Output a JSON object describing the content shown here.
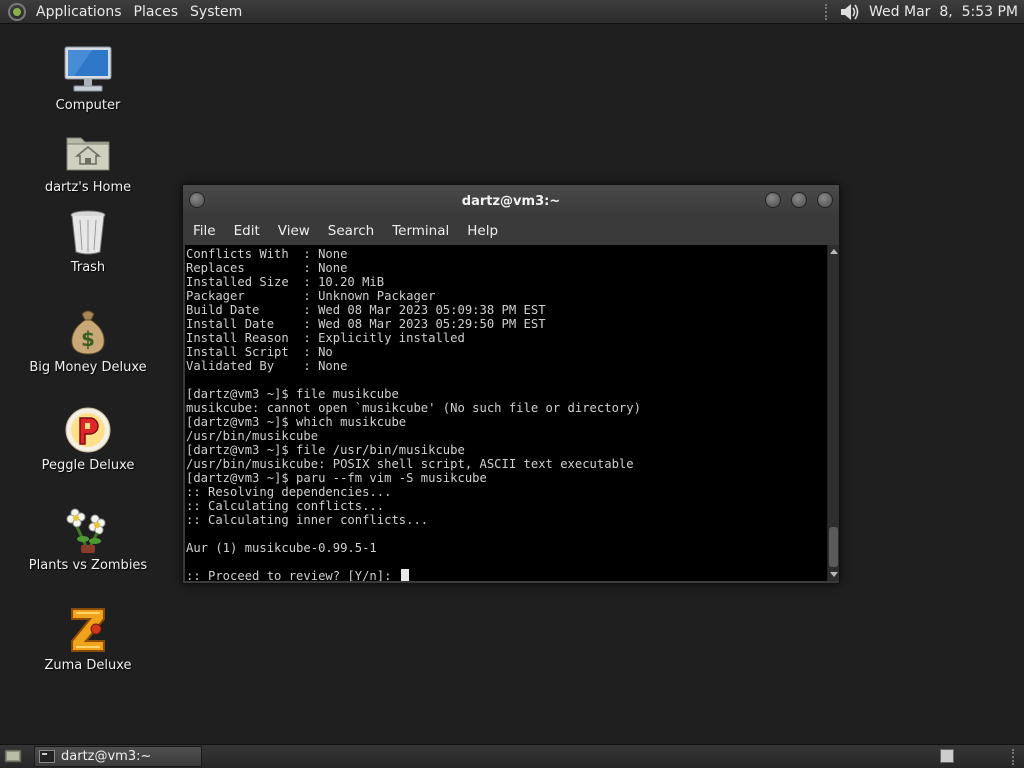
{
  "top_panel": {
    "menus": [
      "Applications",
      "Places",
      "System"
    ],
    "clock": "Wed Mar  8,  5:53 PM"
  },
  "desktop": {
    "icons": [
      {
        "label": "Computer",
        "icon": "computer-icon"
      },
      {
        "label": "dartz's Home",
        "icon": "home-folder-icon"
      },
      {
        "label": "Trash",
        "icon": "trash-icon"
      },
      {
        "label": "Big Money Deluxe",
        "icon": "money-bag-icon"
      },
      {
        "label": "Peggle Deluxe",
        "icon": "peggle-icon"
      },
      {
        "label": "Plants vs Zombies",
        "icon": "flower-icon"
      },
      {
        "label": "Zuma Deluxe",
        "icon": "zuma-icon"
      }
    ]
  },
  "terminal": {
    "title": "dartz@vm3:~",
    "menu": [
      "File",
      "Edit",
      "View",
      "Search",
      "Terminal",
      "Help"
    ],
    "lines": [
      "Conflicts With  : None",
      "Replaces        : None",
      "Installed Size  : 10.20 MiB",
      "Packager        : Unknown Packager",
      "Build Date      : Wed 08 Mar 2023 05:09:38 PM EST",
      "Install Date    : Wed 08 Mar 2023 05:29:50 PM EST",
      "Install Reason  : Explicitly installed",
      "Install Script  : No",
      "Validated By    : None",
      "",
      "[dartz@vm3 ~]$ file musikcube",
      "musikcube: cannot open `musikcube' (No such file or directory)",
      "[dartz@vm3 ~]$ which musikcube",
      "/usr/bin/musikcube",
      "[dartz@vm3 ~]$ file /usr/bin/musikcube",
      "/usr/bin/musikcube: POSIX shell script, ASCII text executable",
      "[dartz@vm3 ~]$ paru --fm vim -S musikcube",
      ":: Resolving dependencies...",
      ":: Calculating conflicts...",
      ":: Calculating inner conflicts...",
      "",
      "Aur (1) musikcube-0.99.5-1",
      ""
    ],
    "prompt": ":: Proceed to review? [Y/n]: "
  },
  "taskbar": {
    "tasks": [
      {
        "label": "dartz@vm3:~"
      }
    ]
  }
}
